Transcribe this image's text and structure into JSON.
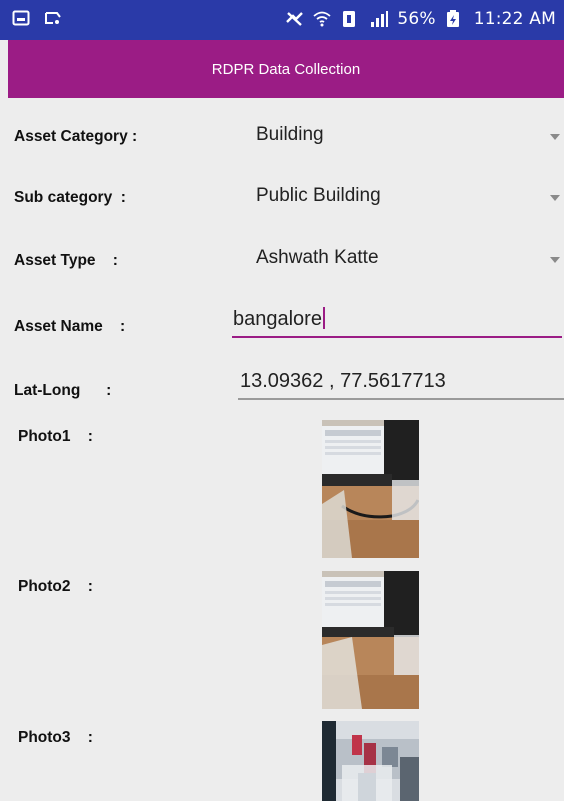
{
  "status_bar": {
    "battery": "56%",
    "time": "11:22 AM",
    "icons": [
      "gallery-notification-icon",
      "cast-notification-icon",
      "mute-icon",
      "wifi-icon",
      "sim-icon",
      "signal-icon",
      "battery-icon"
    ]
  },
  "app_bar": {
    "title": "RDPR Data Collection"
  },
  "form": {
    "asset_category": {
      "label": "Asset Category :",
      "value": "Building"
    },
    "sub_category": {
      "label": "Sub category  :",
      "value": "Public Building"
    },
    "asset_type": {
      "label": "Asset Type    :",
      "value": "Ashwath Katte"
    },
    "asset_name": {
      "label": "Asset Name    :",
      "value": "bangalore"
    },
    "lat_long": {
      "label": "Lat-Long      :",
      "value": "13.09362 , 77.5617713"
    },
    "photo1": {
      "label": "Photo1    :"
    },
    "photo2": {
      "label": "Photo2    :"
    },
    "photo3": {
      "label": "Photo3    :"
    }
  },
  "colors": {
    "status_bar": "#2a3aa8",
    "app_bar": "#9b1c85",
    "accent": "#9b1c85",
    "background": "#ededed"
  }
}
